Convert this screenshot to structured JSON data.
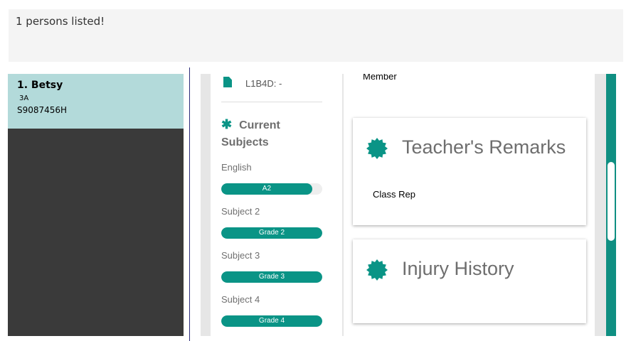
{
  "result": {
    "message": "1 persons listed!"
  },
  "person_list": {
    "items": [
      {
        "index_name": "1.  Betsy",
        "class": "3A",
        "id": "S9087456H"
      }
    ]
  },
  "subjects_card": {
    "l1b4d": "L1B4D: -",
    "heading_icon": "✱",
    "heading": "Current Subjects",
    "subjects": [
      {
        "name": "English",
        "grade": "A2",
        "progress": 0.9
      },
      {
        "name": "Subject 2",
        "grade": "Grade 2",
        "progress": 1.0
      },
      {
        "name": "Subject 3",
        "grade": "Grade 3",
        "progress": 1.0
      },
      {
        "name": "Subject 4",
        "grade": "Grade 4",
        "progress": 1.0
      }
    ]
  },
  "details_panel": {
    "member_text": "Member",
    "remarks_title": "Teacher's Remarks",
    "remarks_body": "Class Rep",
    "injury_title": "Injury History"
  },
  "icons": {
    "document": "document-icon",
    "asterisk": "asterisk-icon",
    "badge": "badge-icon"
  },
  "colors": {
    "accent": "#0a9486",
    "selected": "#b3dada",
    "list_bg": "#3a3a3a"
  }
}
